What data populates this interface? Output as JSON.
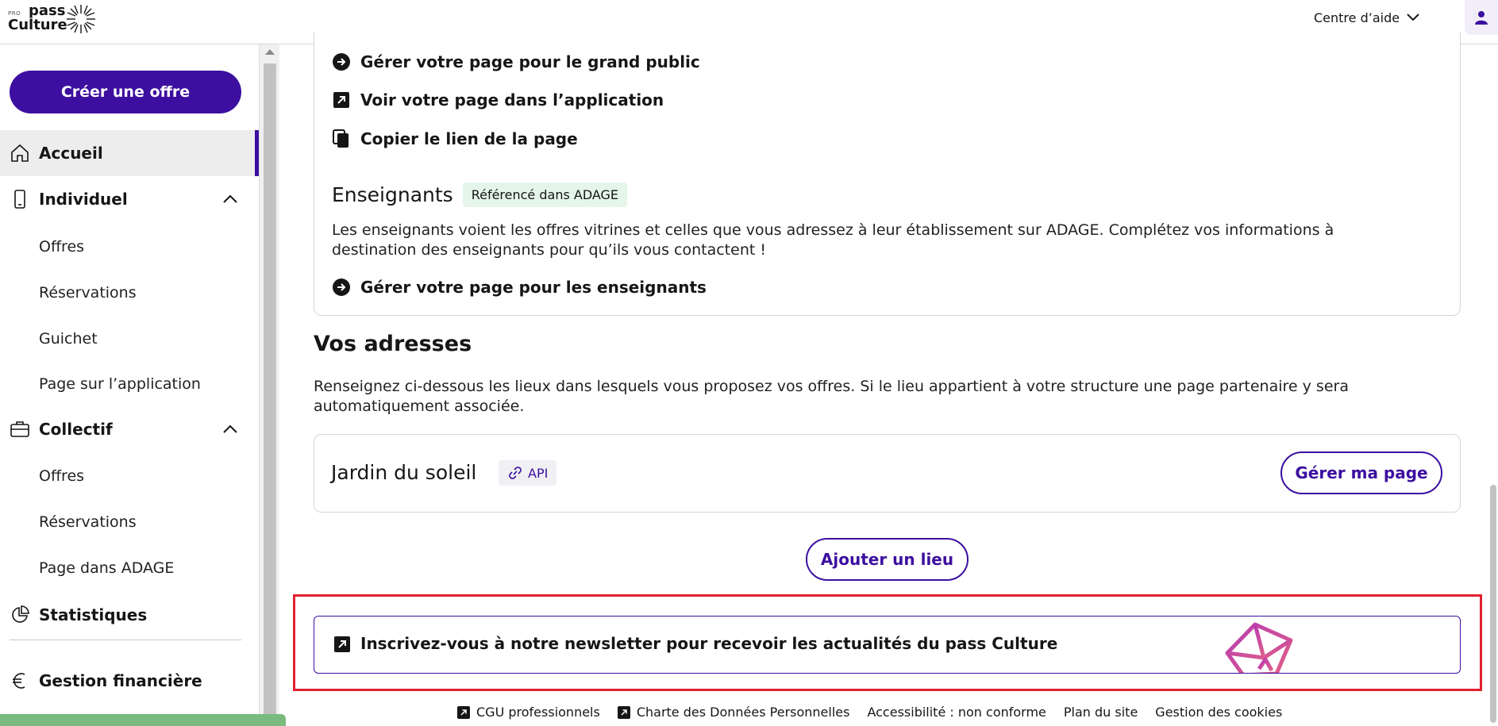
{
  "header": {
    "logo_pro": "PRO",
    "logo_pass": "pass",
    "logo_culture": "Culture",
    "help_label": "Centre d’aide"
  },
  "sidebar": {
    "create_label": "Créer une offre",
    "home": "Accueil",
    "individuel": {
      "label": "Individuel",
      "items": [
        "Offres",
        "Réservations",
        "Guichet",
        "Page sur l’application"
      ]
    },
    "collectif": {
      "label": "Collectif",
      "items": [
        "Offres",
        "Réservations",
        "Page dans ADAGE"
      ]
    },
    "stats": "Statistiques",
    "finance": "Gestion financière"
  },
  "public_card": {
    "links": [
      "Gérer votre page pour le grand public",
      "Voir votre page dans l’application",
      "Copier le lien de la page"
    ],
    "teachers_title": "Enseignants",
    "teachers_tag": "Référencé dans ADAGE",
    "teachers_text_1": "Les enseignants voient les offres vitrines et celles que vous adressez à leur établissement sur ADAGE. Complétez vos informations à",
    "teachers_text_2": "destination des enseignants pour qu’ils vous contactent !",
    "teachers_link": "Gérer votre page pour les enseignants"
  },
  "addresses": {
    "title": "Vos adresses",
    "text_1": "Renseignez ci-dessous les lieux dans lesquels vous proposez vos offres. Si le lieu appartient à votre structure une page partenaire y sera",
    "text_2": "automatiquement associée.",
    "venue_name": "Jardin du soleil",
    "venue_tag": "API",
    "manage_label": "Gérer ma page",
    "add_label": "Ajouter un lieu"
  },
  "newsletter": {
    "label": "Inscrivez-vous à notre newsletter pour recevoir les actualités du pass Culture"
  },
  "footer": {
    "cgu": "CGU professionnels",
    "charte": "Charte des Données Personnelles",
    "access": "Accessibilité : non conforme",
    "plan": "Plan du site",
    "cookies": "Gestion des cookies"
  },
  "colors": {
    "primary": "#3c0fa0",
    "highlight": "#e0202e",
    "tag_green": "#e5f5ea"
  }
}
